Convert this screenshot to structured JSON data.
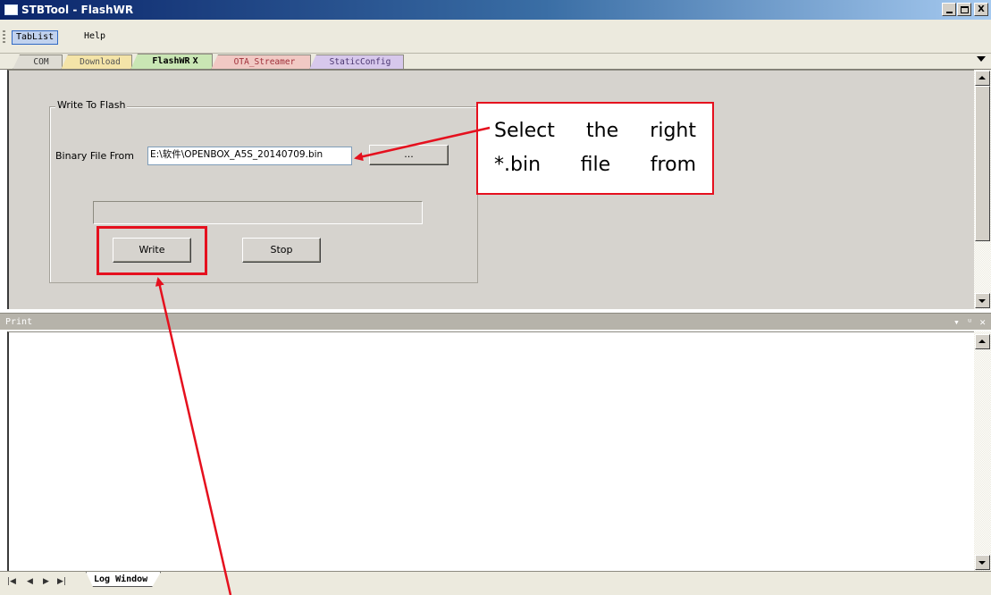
{
  "window": {
    "title": "STBTool - FlashWR",
    "controls": {
      "minimize": "_",
      "maximize": "□",
      "close": "X"
    }
  },
  "menu": {
    "items": [
      {
        "label": "TabList",
        "active": true
      },
      {
        "label": "Help",
        "active": false
      }
    ]
  },
  "tabs": [
    {
      "label": "COM",
      "color": "#dedcd4"
    },
    {
      "label": "Download",
      "color": "#f4e4a8"
    },
    {
      "label": "FlashWR",
      "color": "#c9e6b4",
      "active": true,
      "close": "X"
    },
    {
      "label": "OTA_Streamer",
      "color": "#f1c9c4"
    },
    {
      "label": "StaticConfig",
      "color": "#d7c8ec"
    }
  ],
  "flash_panel": {
    "group_title": "Write To Flash",
    "binary_label": "Binary File From",
    "binary_value": "E:\\软件\\OPENBOX_A5S_20140709.bin",
    "browse_label": "...",
    "progress_value": 0,
    "write_label": "Write",
    "stop_label": "Stop"
  },
  "print_pane": {
    "title": "Print",
    "header_icons": [
      "chevron-down-icon",
      "pin-icon",
      "close-icon"
    ],
    "header_glyphs": {
      "dropdown": "▾",
      "pin": "ᵘ",
      "close": "✕"
    }
  },
  "bottom": {
    "nav": [
      "|◀",
      "◀",
      "▶",
      "▶|"
    ],
    "log_tab": "Log Window"
  },
  "annotation": {
    "callout_line1": "Select the right",
    "callout_line2": "*.bin file from",
    "accent_color": "#e5101e"
  }
}
